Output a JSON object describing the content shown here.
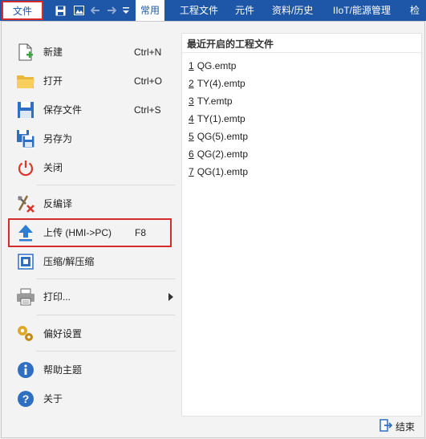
{
  "topbar": {
    "file_tab": "文件",
    "tabs": [
      "常用",
      "工程文件",
      "元件",
      "资料/历史",
      "IIoT/能源管理",
      "检"
    ]
  },
  "menu": {
    "new": {
      "label": "新建",
      "shortcut": "Ctrl+N"
    },
    "open": {
      "label": "打开",
      "shortcut": "Ctrl+O"
    },
    "save": {
      "label": "保存文件",
      "shortcut": "Ctrl+S"
    },
    "save_as": {
      "label": "另存为"
    },
    "close": {
      "label": "关闭"
    },
    "decompile": {
      "label": "反编译"
    },
    "upload": {
      "label": "上传 (HMI->PC)",
      "shortcut": "F8"
    },
    "compress": {
      "label": "压缩/解压缩"
    },
    "print": {
      "label": "打印..."
    },
    "preferences": {
      "label": "偏好设置"
    },
    "help": {
      "label": "帮助主题"
    },
    "about": {
      "label": "关于"
    }
  },
  "recent": {
    "title": "最近开启的工程文件",
    "items": [
      {
        "num": "1",
        "name": "QG.emtp"
      },
      {
        "num": "2",
        "name": "TY(4).emtp"
      },
      {
        "num": "3",
        "name": "TY.emtp"
      },
      {
        "num": "4",
        "name": "TY(1).emtp"
      },
      {
        "num": "5",
        "name": "QG(5).emtp"
      },
      {
        "num": "6",
        "name": "QG(2).emtp"
      },
      {
        "num": "7",
        "name": "QG(1).emtp"
      }
    ]
  },
  "exit": {
    "label": "结束"
  },
  "colors": {
    "ribbon": "#1e56a8",
    "highlight_border": "#d62b2b"
  }
}
